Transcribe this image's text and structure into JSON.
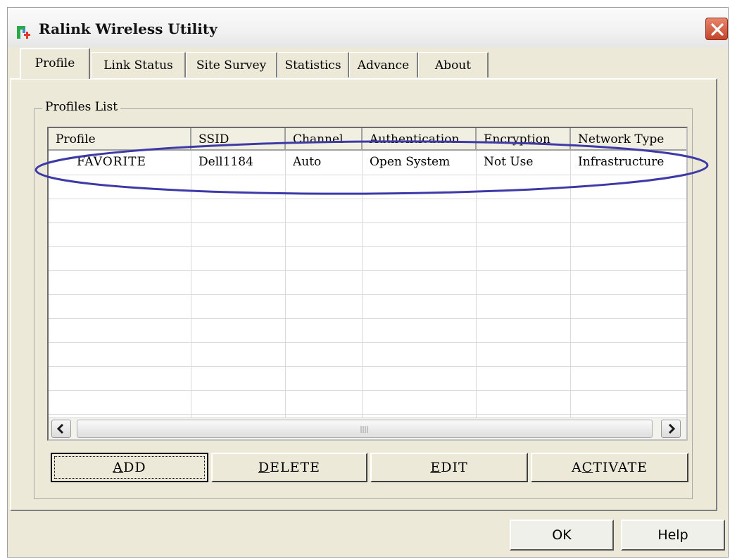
{
  "window": {
    "title": "Ralink Wireless Utility"
  },
  "tabs": [
    {
      "label": "Profile",
      "active": true
    },
    {
      "label": "Link Status"
    },
    {
      "label": "Site Survey"
    },
    {
      "label": "Statistics"
    },
    {
      "label": "Advance"
    },
    {
      "label": "About"
    }
  ],
  "profiles": {
    "group_label": "Profiles List",
    "columns": [
      "Profile",
      "SSID",
      "Channel",
      "Authentication",
      "Encryption",
      "Network Type"
    ],
    "rows": [
      [
        "FAVORITE",
        "Dell1184",
        "Auto",
        "Open System",
        "Not Use",
        "Infrastructure"
      ]
    ]
  },
  "buttons": {
    "add": {
      "mnemonic": "A",
      "rest": "DD"
    },
    "delete": {
      "mnemonic": "D",
      "rest": "ELETE"
    },
    "edit": {
      "mnemonic": "E",
      "rest": "DIT"
    },
    "activate": {
      "pre": "A",
      "mnemonic": "C",
      "rest": "TIVATE"
    },
    "ok": "OK",
    "help": "Help"
  },
  "annotation": {
    "color": "#3d3aa8"
  },
  "icons": {
    "app": "ralink-logo-icon",
    "close": "close-icon",
    "scroll_left": "arrow-left-icon",
    "scroll_right": "arrow-right-icon"
  }
}
